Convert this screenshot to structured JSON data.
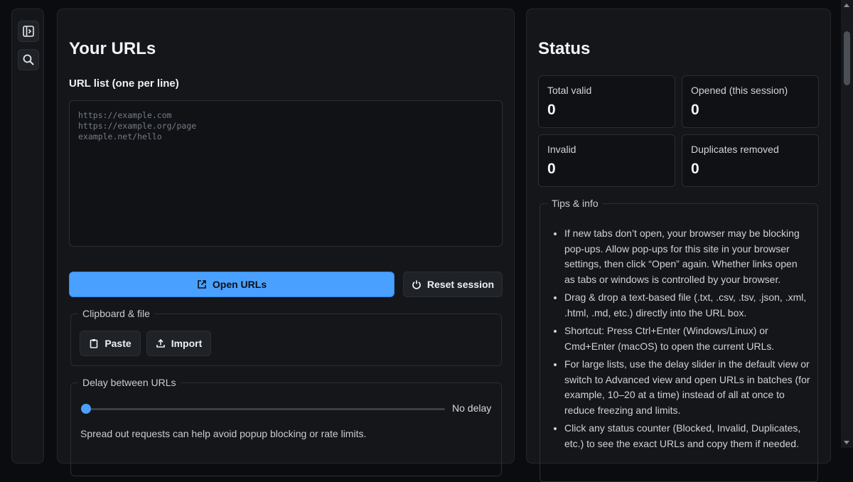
{
  "sidebar": {
    "toggle_icon": "sidebar-toggle-icon",
    "search_icon": "search-icon"
  },
  "urls_panel": {
    "title": "Your URLs",
    "list_label": "URL list (one per line)",
    "textarea_value": "",
    "textarea_placeholder": "https://example.com\nhttps://example.org/page\nexample.net/hello",
    "open_button": "Open URLs",
    "reset_button": "Reset session",
    "clipboard_group": {
      "legend": "Clipboard & file",
      "paste_button": "Paste",
      "import_button": "Import"
    },
    "delay_group": {
      "legend": "Delay between URLs",
      "slider_value_fraction": 0,
      "value_label": "No delay",
      "hint": "Spread out requests can help avoid popup blocking or rate limits."
    }
  },
  "status_panel": {
    "title": "Status",
    "stats": [
      {
        "label": "Total valid",
        "value": "0"
      },
      {
        "label": "Opened (this session)",
        "value": "0"
      },
      {
        "label": "Invalid",
        "value": "0"
      },
      {
        "label": "Duplicates removed",
        "value": "0"
      }
    ],
    "tips": {
      "legend": "Tips & info",
      "items": [
        "If new tabs don’t open, your browser may be blocking pop-ups. Allow pop-ups for this site in your browser settings, then click “Open” again. Whether links open as tabs or windows is controlled by your browser.",
        "Drag & drop a text-based file (.txt, .csv, .tsv, .json, .xml, .html, .md, etc.) directly into the URL box.",
        "Shortcut: Press Ctrl+Enter (Windows/Linux) or Cmd+Enter (macOS) to open the current URLs.",
        "For large lists, use the delay slider in the default view or switch to Advanced view and open URLs in batches (for example, 10–20 at a time) instead of all at once to reduce freezing and limits.",
        "Click any status counter (Blocked, Invalid, Duplicates, etc.) to see the exact URLs and copy them if needed."
      ]
    }
  },
  "colors": {
    "accent": "#4aa0ff",
    "background": "#0b0c0f",
    "panel": "#141619"
  }
}
